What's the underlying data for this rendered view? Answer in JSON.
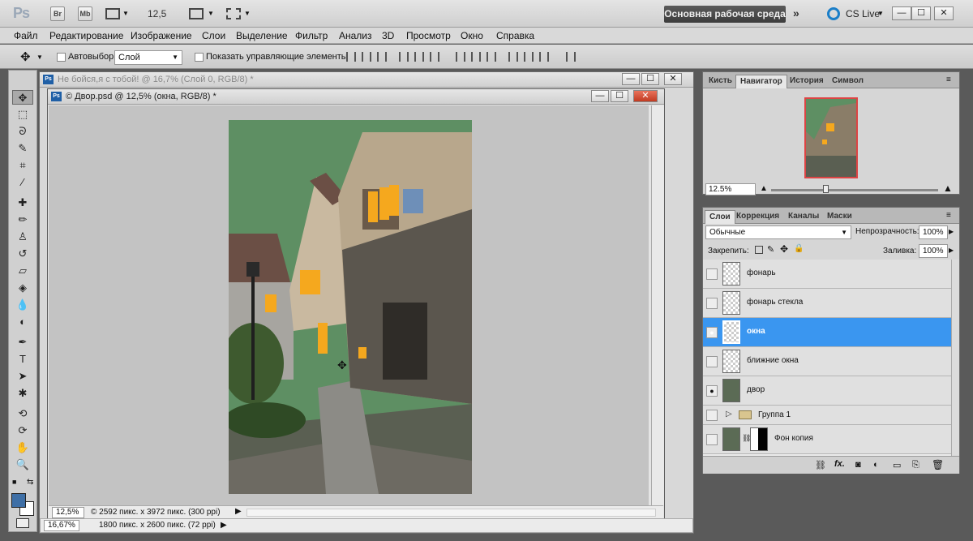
{
  "app": {
    "logo": "Ps",
    "bridge_label": "Br",
    "minibridge_label": "Mb",
    "zoom_value": "12,5",
    "workspace_label": "Основная рабочая среда",
    "cslive_label": "CS Live",
    "more_icon": "double-chevron-right",
    "minimize": "—",
    "restore": "☐",
    "close": "✕"
  },
  "menu": {
    "items": [
      "Файл",
      "Редактирование",
      "Изображение",
      "Слои",
      "Выделение",
      "Фильтр",
      "Анализ",
      "3D",
      "Просмотр",
      "Окно",
      "Справка"
    ]
  },
  "options": {
    "autoselect_label": "Автовыбор:",
    "autoselect_value": "Слой",
    "show_controls_label": "Показать управляющие элементы"
  },
  "doc_back": {
    "title": "Не бойся,я с тобой! @ 16,7% (Слой 0, RGB/8) *",
    "status_zoom": "16,67%",
    "status_info": "1800 пикс. x 2600 пикс. (72 ppi)"
  },
  "doc_front": {
    "title": "© Двор.psd @ 12,5% (окна, RGB/8) *",
    "status_zoom": "12,5%",
    "status_info": "© 2592 пикс. x 3972 пикс. (300 ppi)",
    "canvas_bg_color": "#5e8f63"
  },
  "navigator": {
    "tabs": [
      "Кисть",
      "Навигатор",
      "История",
      "Символ"
    ],
    "active_tab": "Навигатор",
    "zoom": "12.5%"
  },
  "layers": {
    "tabs": [
      "Слои",
      "Коррекция",
      "Каналы",
      "Маски"
    ],
    "blend_mode": "Обычные",
    "opacity_label": "Непрозрачность:",
    "opacity_value": "100%",
    "lock_label": "Закрепить:",
    "fill_label": "Заливка:",
    "fill_value": "100%",
    "items": [
      {
        "name": "фонарь",
        "visible": false,
        "selected": false
      },
      {
        "name": "фонарь стекла",
        "visible": false,
        "selected": false
      },
      {
        "name": "окна",
        "visible": true,
        "selected": true
      },
      {
        "name": "ближние окна",
        "visible": false,
        "selected": false
      },
      {
        "name": "двор",
        "visible": true,
        "selected": false
      },
      {
        "name": "Группа 1",
        "visible": false,
        "selected": false,
        "group": true
      },
      {
        "name": "Фон копия",
        "visible": false,
        "selected": false
      }
    ]
  },
  "colors": {
    "selection_blue": "#3a96f0",
    "foreground": "#3e6fa6",
    "background": "#ffffff",
    "window_orange": "#f5a81e"
  }
}
